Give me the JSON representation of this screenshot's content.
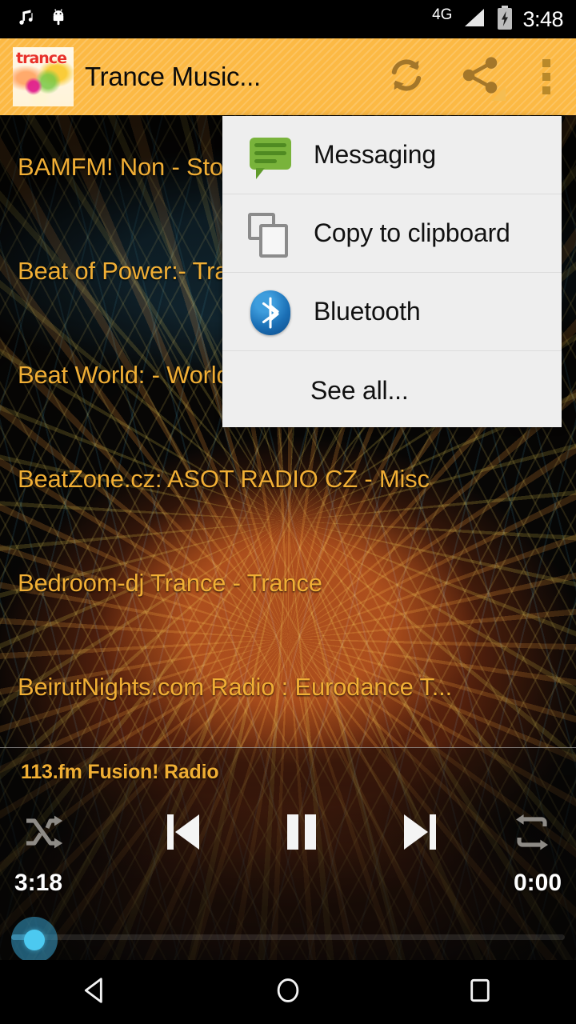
{
  "status_bar": {
    "music_icon": "music-note-icon",
    "android_icon": "android-robot-icon",
    "network_label": "4G",
    "signal_icon": "signal-bars-icon",
    "battery_icon": "battery-charging-icon",
    "clock": "3:48"
  },
  "app_bar": {
    "app_icon": "trance-app-logo-icon",
    "logo_word": "trance",
    "title": "Trance Music...",
    "refresh_icon": "refresh-icon",
    "share_icon": "share-icon",
    "overflow_icon": "overflow-menu-icon",
    "background_color": "#fcb944",
    "title_color": "#0a0a0a"
  },
  "stations": [
    {
      "name": "BAMFM! Non - Stop Trance - Trance"
    },
    {
      "name": "Beat of Power:- Trance"
    },
    {
      "name": "Beat World: - World"
    },
    {
      "name": "BeatZone.cz: ASOT RADIO CZ - Misc"
    },
    {
      "name": "Bedroom-dj Trance  - Trance"
    },
    {
      "name": "BeirutNights.com Radio : Eurodance T..."
    }
  ],
  "station_text_color": "#f0ae35",
  "share_menu": {
    "items": [
      {
        "label": "Messaging",
        "icon": "messaging-icon"
      },
      {
        "label": "Copy to clipboard",
        "icon": "clipboard-copy-icon"
      },
      {
        "label": "Bluetooth",
        "icon": "bluetooth-icon"
      },
      {
        "label": "See all...",
        "icon": "none"
      }
    ],
    "background_color": "#eeeeee"
  },
  "player": {
    "now_playing_title": "113.fm Fusion! Radio",
    "shuffle_icon": "shuffle-icon",
    "previous_icon": "skip-previous-icon",
    "play_pause_icon": "pause-icon",
    "next_icon": "skip-next-icon",
    "repeat_icon": "repeat-icon",
    "elapsed_time": "3:18",
    "remaining_time": "0:00",
    "seek_thumb_color": "#4cc9f0",
    "title_color": "#efae34"
  },
  "nav_bar": {
    "back_icon": "back-triangle-icon",
    "home_icon": "home-circle-icon",
    "recents_icon": "recents-square-icon"
  }
}
